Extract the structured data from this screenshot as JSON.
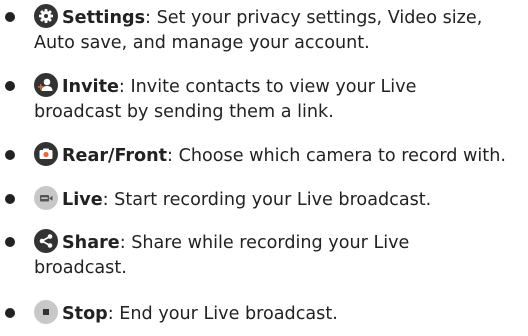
{
  "items": [
    {
      "icon": "gear-icon",
      "term": "Settings",
      "line1": ": Set your privacy settings, Video size,",
      "line2": "Auto save, and manage your account."
    },
    {
      "icon": "invite-person-icon",
      "term": "Invite",
      "line1": ": Invite contacts to view your Live",
      "line2": "broadcast by sending them a link."
    },
    {
      "icon": "switch-camera-icon",
      "term": "Rear/Front",
      "line1": ": Choose which camera to record with.",
      "line2": ""
    },
    {
      "icon": "live-video-icon",
      "term": "Live",
      "line1": ": Start recording your Live broadcast.",
      "line2": ""
    },
    {
      "icon": "share-icon",
      "term": "Share",
      "line1": ": Share while recording your Live",
      "line2": "broadcast."
    },
    {
      "icon": "stop-icon",
      "term": "Stop",
      "line1": ": End your Live broadcast.",
      "line2": ""
    }
  ],
  "colors": {
    "text": "#222222",
    "icon_dark": "#333333",
    "icon_orange": "#e8683a",
    "icon_light": "#c8c8c8"
  }
}
